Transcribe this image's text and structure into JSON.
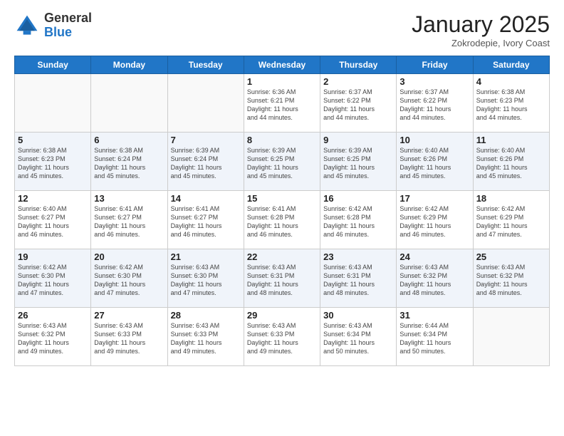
{
  "header": {
    "logo_general": "General",
    "logo_blue": "Blue",
    "title": "January 2025",
    "location": "Zokrodepie, Ivory Coast"
  },
  "days_of_week": [
    "Sunday",
    "Monday",
    "Tuesday",
    "Wednesday",
    "Thursday",
    "Friday",
    "Saturday"
  ],
  "weeks": [
    [
      {
        "day": "",
        "info": ""
      },
      {
        "day": "",
        "info": ""
      },
      {
        "day": "",
        "info": ""
      },
      {
        "day": "1",
        "info": "Sunrise: 6:36 AM\nSunset: 6:21 PM\nDaylight: 11 hours\nand 44 minutes."
      },
      {
        "day": "2",
        "info": "Sunrise: 6:37 AM\nSunset: 6:22 PM\nDaylight: 11 hours\nand 44 minutes."
      },
      {
        "day": "3",
        "info": "Sunrise: 6:37 AM\nSunset: 6:22 PM\nDaylight: 11 hours\nand 44 minutes."
      },
      {
        "day": "4",
        "info": "Sunrise: 6:38 AM\nSunset: 6:23 PM\nDaylight: 11 hours\nand 44 minutes."
      }
    ],
    [
      {
        "day": "5",
        "info": "Sunrise: 6:38 AM\nSunset: 6:23 PM\nDaylight: 11 hours\nand 45 minutes."
      },
      {
        "day": "6",
        "info": "Sunrise: 6:38 AM\nSunset: 6:24 PM\nDaylight: 11 hours\nand 45 minutes."
      },
      {
        "day": "7",
        "info": "Sunrise: 6:39 AM\nSunset: 6:24 PM\nDaylight: 11 hours\nand 45 minutes."
      },
      {
        "day": "8",
        "info": "Sunrise: 6:39 AM\nSunset: 6:25 PM\nDaylight: 11 hours\nand 45 minutes."
      },
      {
        "day": "9",
        "info": "Sunrise: 6:39 AM\nSunset: 6:25 PM\nDaylight: 11 hours\nand 45 minutes."
      },
      {
        "day": "10",
        "info": "Sunrise: 6:40 AM\nSunset: 6:26 PM\nDaylight: 11 hours\nand 45 minutes."
      },
      {
        "day": "11",
        "info": "Sunrise: 6:40 AM\nSunset: 6:26 PM\nDaylight: 11 hours\nand 45 minutes."
      }
    ],
    [
      {
        "day": "12",
        "info": "Sunrise: 6:40 AM\nSunset: 6:27 PM\nDaylight: 11 hours\nand 46 minutes."
      },
      {
        "day": "13",
        "info": "Sunrise: 6:41 AM\nSunset: 6:27 PM\nDaylight: 11 hours\nand 46 minutes."
      },
      {
        "day": "14",
        "info": "Sunrise: 6:41 AM\nSunset: 6:27 PM\nDaylight: 11 hours\nand 46 minutes."
      },
      {
        "day": "15",
        "info": "Sunrise: 6:41 AM\nSunset: 6:28 PM\nDaylight: 11 hours\nand 46 minutes."
      },
      {
        "day": "16",
        "info": "Sunrise: 6:42 AM\nSunset: 6:28 PM\nDaylight: 11 hours\nand 46 minutes."
      },
      {
        "day": "17",
        "info": "Sunrise: 6:42 AM\nSunset: 6:29 PM\nDaylight: 11 hours\nand 46 minutes."
      },
      {
        "day": "18",
        "info": "Sunrise: 6:42 AM\nSunset: 6:29 PM\nDaylight: 11 hours\nand 47 minutes."
      }
    ],
    [
      {
        "day": "19",
        "info": "Sunrise: 6:42 AM\nSunset: 6:30 PM\nDaylight: 11 hours\nand 47 minutes."
      },
      {
        "day": "20",
        "info": "Sunrise: 6:42 AM\nSunset: 6:30 PM\nDaylight: 11 hours\nand 47 minutes."
      },
      {
        "day": "21",
        "info": "Sunrise: 6:43 AM\nSunset: 6:30 PM\nDaylight: 11 hours\nand 47 minutes."
      },
      {
        "day": "22",
        "info": "Sunrise: 6:43 AM\nSunset: 6:31 PM\nDaylight: 11 hours\nand 48 minutes."
      },
      {
        "day": "23",
        "info": "Sunrise: 6:43 AM\nSunset: 6:31 PM\nDaylight: 11 hours\nand 48 minutes."
      },
      {
        "day": "24",
        "info": "Sunrise: 6:43 AM\nSunset: 6:32 PM\nDaylight: 11 hours\nand 48 minutes."
      },
      {
        "day": "25",
        "info": "Sunrise: 6:43 AM\nSunset: 6:32 PM\nDaylight: 11 hours\nand 48 minutes."
      }
    ],
    [
      {
        "day": "26",
        "info": "Sunrise: 6:43 AM\nSunset: 6:32 PM\nDaylight: 11 hours\nand 49 minutes."
      },
      {
        "day": "27",
        "info": "Sunrise: 6:43 AM\nSunset: 6:33 PM\nDaylight: 11 hours\nand 49 minutes."
      },
      {
        "day": "28",
        "info": "Sunrise: 6:43 AM\nSunset: 6:33 PM\nDaylight: 11 hours\nand 49 minutes."
      },
      {
        "day": "29",
        "info": "Sunrise: 6:43 AM\nSunset: 6:33 PM\nDaylight: 11 hours\nand 49 minutes."
      },
      {
        "day": "30",
        "info": "Sunrise: 6:43 AM\nSunset: 6:34 PM\nDaylight: 11 hours\nand 50 minutes."
      },
      {
        "day": "31",
        "info": "Sunrise: 6:44 AM\nSunset: 6:34 PM\nDaylight: 11 hours\nand 50 minutes."
      },
      {
        "day": "",
        "info": ""
      }
    ]
  ]
}
